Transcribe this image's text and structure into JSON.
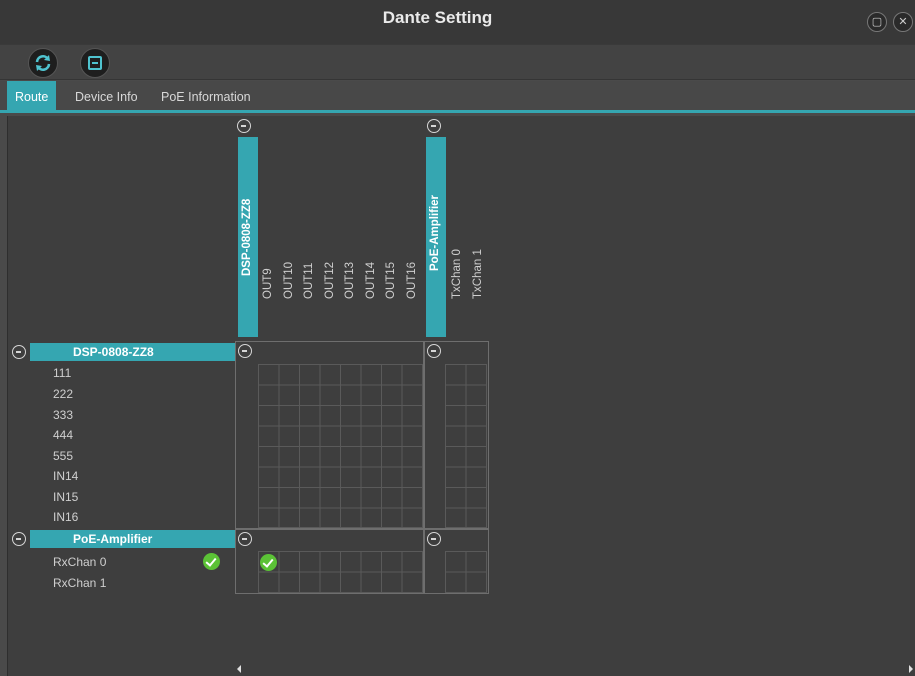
{
  "window": {
    "title": "Dante Setting"
  },
  "toolbar": {
    "refresh_icon": "refresh-icon",
    "collapse_icon": "collapse-icon"
  },
  "tabs": [
    {
      "label": "Route",
      "active": true
    },
    {
      "label": "Device Info",
      "active": false
    },
    {
      "label": "PoE Information",
      "active": false
    }
  ],
  "transmitters": [
    {
      "name": "DSP-0808-ZZ8",
      "channels": [
        "OUT9",
        "OUT10",
        "OUT11",
        "OUT12",
        "OUT13",
        "OUT14",
        "OUT15",
        "OUT16"
      ]
    },
    {
      "name": "PoE-Amplifier",
      "channels": [
        "TxChan 0",
        "TxChan 1"
      ]
    }
  ],
  "receivers": [
    {
      "name": "DSP-0808-ZZ8",
      "channels": [
        "111",
        "222",
        "333",
        "444",
        "555",
        "IN14",
        "IN15",
        "IN16"
      ]
    },
    {
      "name": "PoE-Amplifier",
      "channels": [
        "RxChan 0",
        "RxChan 1"
      ],
      "status_icon": "check-icon"
    }
  ],
  "routes": [
    {
      "rx": "PoE-Amplifier / RxChan 0",
      "tx": "DSP-0808-ZZ8 / OUT9"
    }
  ],
  "colors": {
    "accent": "#35a6b1",
    "ok": "#5bc236",
    "background": "#3e3e3e"
  }
}
